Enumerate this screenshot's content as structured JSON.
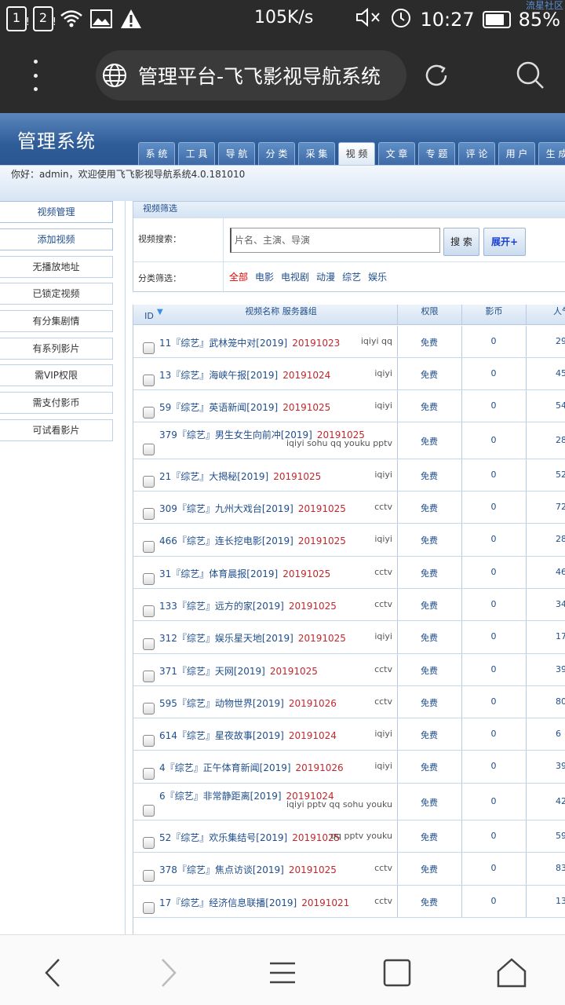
{
  "status_bar": {
    "sim1": "1",
    "sim2": "2",
    "speed": "105K/s",
    "time": "10:27",
    "battery": "85%",
    "watermark": "流星社区"
  },
  "browser": {
    "title": "管理平台-飞飞影视导航系统"
  },
  "header": {
    "system_title": "管理系统",
    "tabs": [
      "系 统",
      "工 具",
      "导 航",
      "分 类",
      "采 集",
      "视 频",
      "文 章",
      "专 题",
      "评 论",
      "用 户",
      "生 成"
    ],
    "active_tab": "视 频",
    "welcome": "你好：admin，欢迎使用飞飞影视导航系统4.0.181010"
  },
  "sidebar": {
    "items": [
      "视频管理",
      "添加视频",
      "无播放地址",
      "已锁定视频",
      "有分集剧情",
      "有系列影片",
      "需VIP权限",
      "需支付影币",
      "可试看影片"
    ]
  },
  "filter": {
    "title": "视频筛选",
    "search_label": "视频搜索：",
    "search_placeholder": "片名、主演、导演",
    "search_button": "搜 索",
    "expand_button": "展开+",
    "category_label": "分类筛选：",
    "categories": [
      "全部",
      "电影",
      "电视剧",
      "动漫",
      "综艺",
      "娱乐"
    ],
    "selected_category": "全部"
  },
  "table": {
    "headers": {
      "id": "ID",
      "name": "视频名称 服务器组",
      "permission": "权限",
      "coins": "影币",
      "popularity": "人气"
    },
    "rows": [
      {
        "id": "11",
        "title": "『综艺』武林笼中对[2019]",
        "date": "20191023",
        "sources": "iqiyi qq",
        "permission": "免费",
        "coins": "0",
        "popularity": "29"
      },
      {
        "id": "13",
        "title": "『综艺』海峡午报[2019]",
        "date": "20191024",
        "sources": "iqiyi",
        "permission": "免费",
        "coins": "0",
        "popularity": "45"
      },
      {
        "id": "59",
        "title": "『综艺』英语新闻[2019]",
        "date": "20191025",
        "sources": "iqiyi",
        "permission": "免费",
        "coins": "0",
        "popularity": "54"
      },
      {
        "id": "379",
        "title": "『综艺』男生女生向前冲[2019]",
        "date": "20191025",
        "sources": "iqiyi sohu qq youku pptv",
        "permission": "免费",
        "coins": "0",
        "popularity": "28"
      },
      {
        "id": "21",
        "title": "『综艺』大揭秘[2019]",
        "date": "20191025",
        "sources": "iqiyi",
        "permission": "免费",
        "coins": "0",
        "popularity": "52"
      },
      {
        "id": "309",
        "title": "『综艺』九州大戏台[2019]",
        "date": "20191025",
        "sources": "cctv",
        "permission": "免费",
        "coins": "0",
        "popularity": "72"
      },
      {
        "id": "466",
        "title": "『综艺』连长挖电影[2019]",
        "date": "20191025",
        "sources": "iqiyi",
        "permission": "免费",
        "coins": "0",
        "popularity": "28"
      },
      {
        "id": "31",
        "title": "『综艺』体育晨报[2019]",
        "date": "20191025",
        "sources": "cctv",
        "permission": "免费",
        "coins": "0",
        "popularity": "46"
      },
      {
        "id": "133",
        "title": "『综艺』远方的家[2019]",
        "date": "20191025",
        "sources": "cctv",
        "permission": "免费",
        "coins": "0",
        "popularity": "34"
      },
      {
        "id": "312",
        "title": "『综艺』娱乐星天地[2019]",
        "date": "20191025",
        "sources": "iqiyi",
        "permission": "免费",
        "coins": "0",
        "popularity": "17"
      },
      {
        "id": "371",
        "title": "『综艺』天网[2019]",
        "date": "20191025",
        "sources": "cctv",
        "permission": "免费",
        "coins": "0",
        "popularity": "39"
      },
      {
        "id": "595",
        "title": "『综艺』动物世界[2019]",
        "date": "20191026",
        "sources": "cctv",
        "permission": "免费",
        "coins": "0",
        "popularity": "80"
      },
      {
        "id": "614",
        "title": "『综艺』星夜故事[2019]",
        "date": "20191024",
        "sources": "iqiyi",
        "permission": "免费",
        "coins": "0",
        "popularity": "6"
      },
      {
        "id": "4",
        "title": "『综艺』正午体育新闻[2019]",
        "date": "20191026",
        "sources": "iqiyi",
        "permission": "免费",
        "coins": "0",
        "popularity": "39"
      },
      {
        "id": "6",
        "title": "『综艺』非常静距离[2019]",
        "date": "20191024",
        "sources": "iqiyi pptv qq sohu youku",
        "permission": "免费",
        "coins": "0",
        "popularity": "42"
      },
      {
        "id": "52",
        "title": "『综艺』欢乐集结号[2019]",
        "date": "20191025",
        "sources": "qq pptv youku",
        "permission": "免费",
        "coins": "0",
        "popularity": "59"
      },
      {
        "id": "378",
        "title": "『综艺』焦点访谈[2019]",
        "date": "20191025",
        "sources": "cctv",
        "permission": "免费",
        "coins": "0",
        "popularity": "83"
      },
      {
        "id": "17",
        "title": "『综艺』经济信息联播[2019]",
        "date": "20191021",
        "sources": "cctv",
        "permission": "免费",
        "coins": "0",
        "popularity": "13"
      }
    ]
  }
}
